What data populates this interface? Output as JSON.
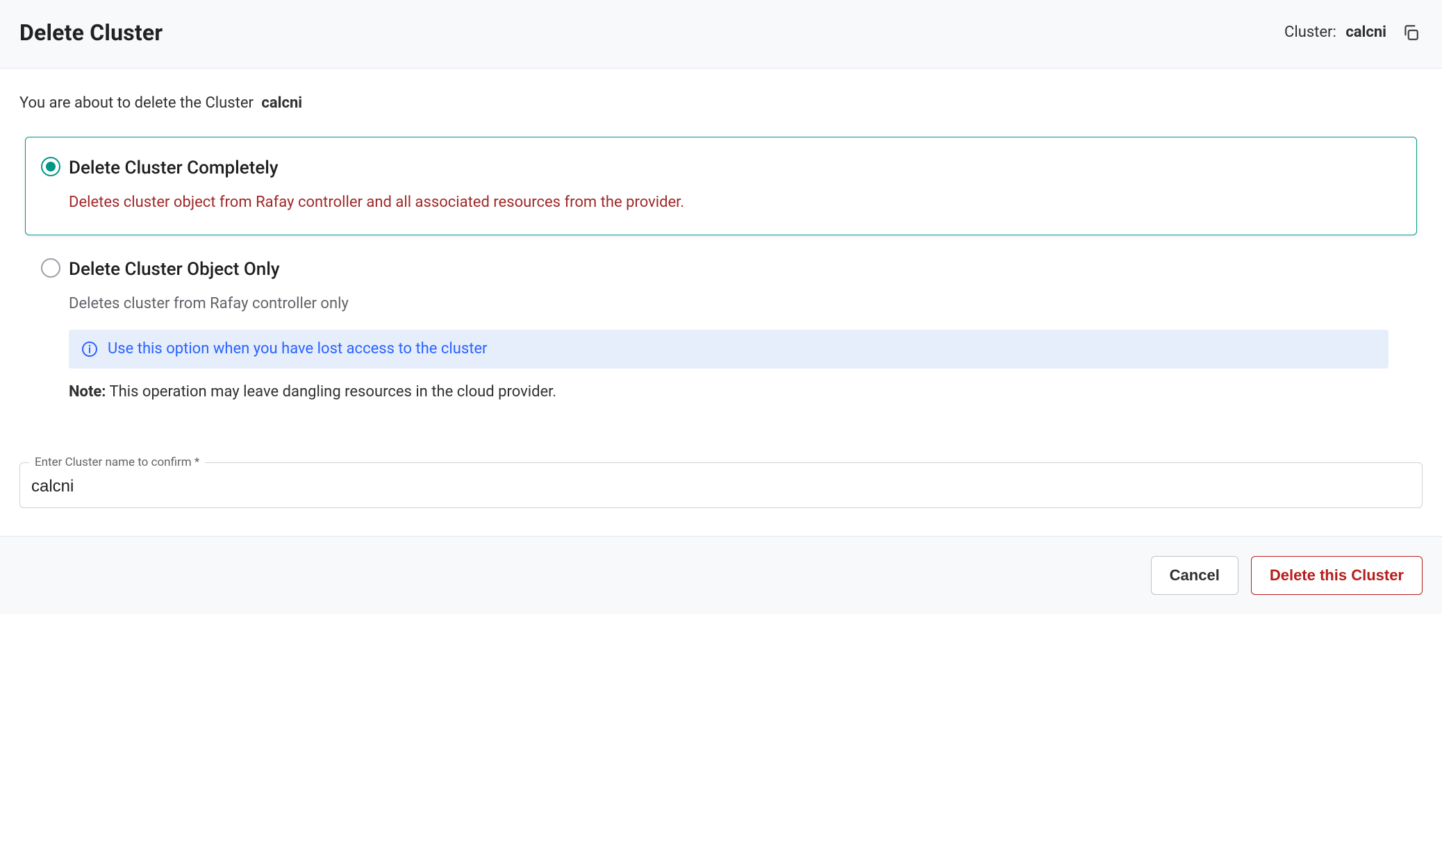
{
  "header": {
    "title": "Delete Cluster",
    "cluster_label": "Cluster:",
    "cluster_name": "calcni"
  },
  "intro": {
    "prefix": "You are about to delete the Cluster",
    "name": "calcni"
  },
  "options": {
    "complete": {
      "title": "Delete Cluster Completely",
      "desc": "Deletes cluster object from Rafay controller and all associated resources from the provider.",
      "selected": true
    },
    "object_only": {
      "title": "Delete Cluster Object Only",
      "desc": "Deletes cluster from Rafay controller only",
      "info": "Use this option when you have lost access to the cluster",
      "note_label": "Note:",
      "note_text": " This operation may leave dangling resources in the cloud provider.",
      "selected": false
    }
  },
  "confirm_field": {
    "label": "Enter Cluster name to confirm *",
    "value": "calcni"
  },
  "footer": {
    "cancel": "Cancel",
    "delete": "Delete this Cluster"
  }
}
